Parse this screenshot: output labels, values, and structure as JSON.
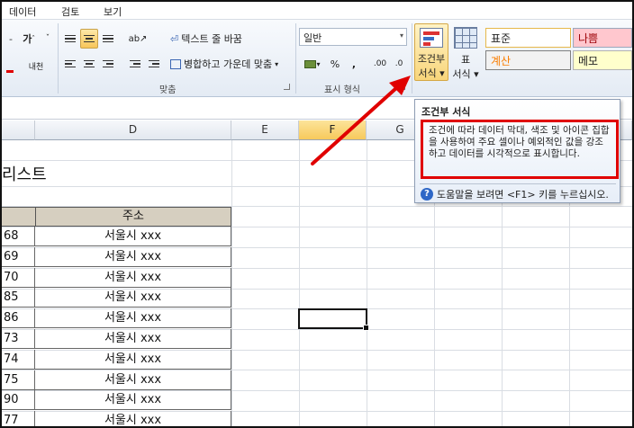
{
  "menu": [
    "데이터",
    "검토",
    "보기"
  ],
  "ribbon": {
    "font_group": {
      "increase_font": "가",
      "font_color_label": "내천"
    },
    "alignment": {
      "wrap_text": "텍스트 줄 바꿈",
      "merge_center": "병합하고 가운데 맞춤",
      "group_label": "맞춤"
    },
    "number": {
      "format_value": "일반",
      "percent": "%",
      "comma": ",",
      "inc_decimal": ".00",
      "dec_decimal": ".0",
      "group_label": "표시 형식"
    },
    "styles": {
      "conditional_line1": "조건부",
      "conditional_line2": "서식",
      "table_line1": "표",
      "table_line2": "서식",
      "style_normal": "표준",
      "style_bad": "나쁨",
      "style_calc": "계산",
      "style_memo": "메모"
    }
  },
  "grid": {
    "columns": [
      "D",
      "E",
      "F",
      "G"
    ],
    "selected_column": "F",
    "title_fragment": "리스트",
    "table_header": "주소",
    "rows": [
      {
        "num": "68",
        "addr": "서울시 xxx"
      },
      {
        "num": "69",
        "addr": "서울시 xxx"
      },
      {
        "num": "70",
        "addr": "서울시 xxx"
      },
      {
        "num": "85",
        "addr": "서울시 xxx"
      },
      {
        "num": "86",
        "addr": "서울시 xxx"
      },
      {
        "num": "73",
        "addr": "서울시 xxx"
      },
      {
        "num": "74",
        "addr": "서울시 xxx"
      },
      {
        "num": "75",
        "addr": "서울시 xxx"
      },
      {
        "num": "90",
        "addr": "서울시 xxx"
      },
      {
        "num": "77",
        "addr": "서울시 xxx"
      }
    ]
  },
  "tooltip": {
    "title": "조건부 서식",
    "description": "조건에 따라 데이터 막대, 색조 및 아이콘 집합을 사용하여 주요 셀이나 예외적인 값을 강조하고 데이터를 시각적으로 표시합니다.",
    "help": "도움말을 보려면 <F1> 키를 누르십시오."
  },
  "colors": {
    "annotation_red": "#e00000",
    "selected_header": "#f7c95b",
    "style_bad_bg": "#ffc7ce",
    "style_calc_bg": "#f2f2f2",
    "style_calc_fg": "#fa7d00",
    "style_memo_bg": "#ffffcc"
  }
}
